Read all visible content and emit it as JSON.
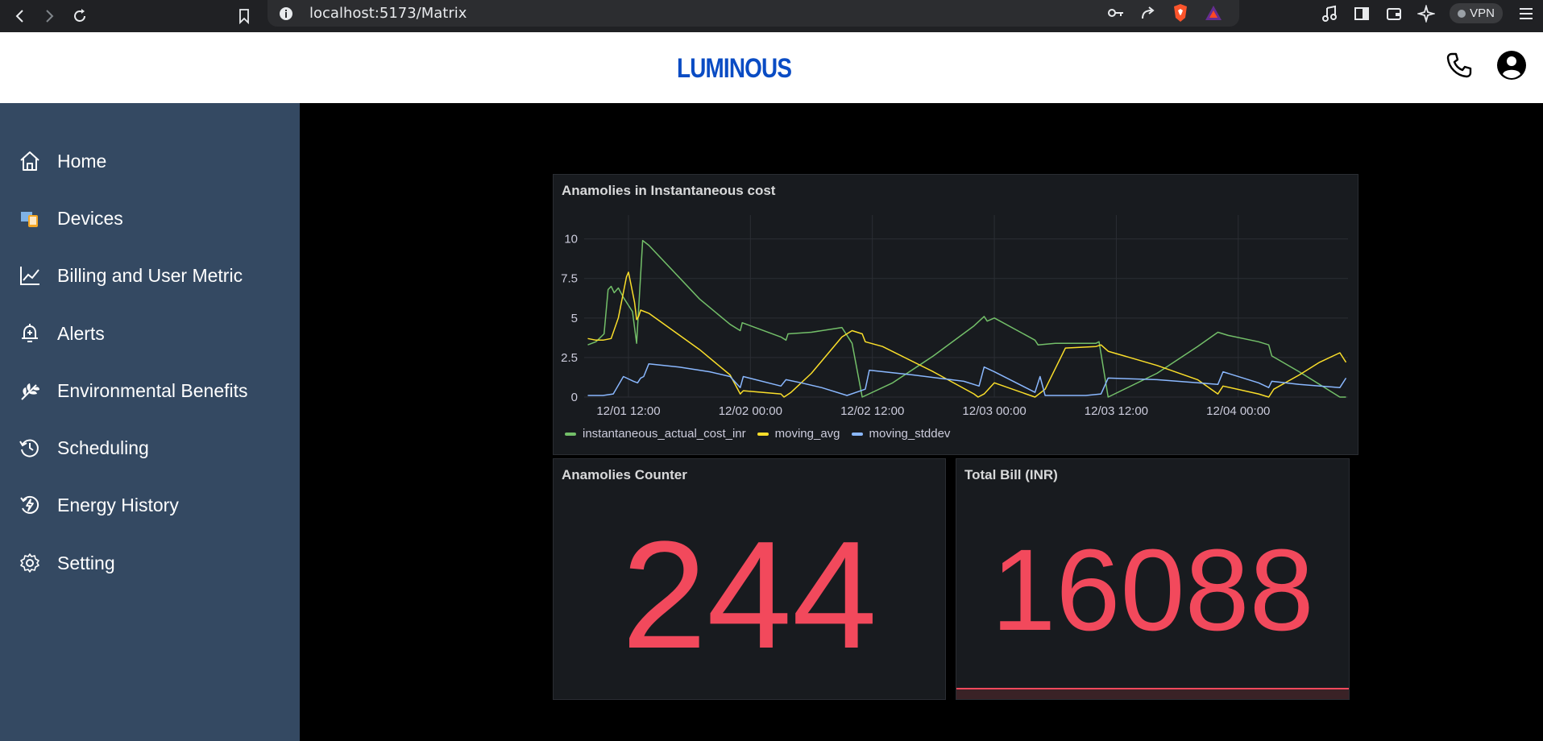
{
  "browser": {
    "url": "localhost:5173/Matrix",
    "vpn_label": "VPN"
  },
  "header": {
    "logo": "LUMINOUS"
  },
  "sidebar": {
    "items": [
      {
        "label": "Home",
        "icon": "home-icon"
      },
      {
        "label": "Devices",
        "icon": "devices-icon"
      },
      {
        "label": "Billing and User Metric",
        "icon": "chart-line-icon"
      },
      {
        "label": "Alerts",
        "icon": "alert-bell-icon"
      },
      {
        "label": "Environmental Benefits",
        "icon": "leaf-icon"
      },
      {
        "label": "Scheduling",
        "icon": "history-clock-icon"
      },
      {
        "label": "Energy History",
        "icon": "energy-bolt-icon"
      },
      {
        "label": "Setting",
        "icon": "gear-icon"
      }
    ]
  },
  "panels": {
    "chart_title": "Anamolies in Instantaneous cost",
    "counter_title": "Anamolies Counter",
    "counter_value": "244",
    "bill_title": "Total Bill (INR)",
    "bill_value": "16088"
  },
  "colors": {
    "sidebar_bg": "#344962",
    "panel_bg": "#181b1f",
    "stat_red": "#f2495c",
    "series_green": "#73bf69",
    "series_yellow": "#fade2a",
    "series_blue": "#8ab8ff"
  },
  "chart_data": {
    "type": "line",
    "title": "Anamolies in Instantaneous cost",
    "x_ticks": [
      "12/01 12:00",
      "12/02 00:00",
      "12/02 12:00",
      "12/03 00:00",
      "12/03 12:00",
      "12/04 00:00"
    ],
    "x_tick_hours": [
      12,
      24,
      36,
      48,
      60,
      72
    ],
    "xlim_hours": [
      7.8,
      82.8
    ],
    "y_ticks": [
      "0",
      "2.5",
      "5",
      "7.5",
      "10"
    ],
    "ylim": [
      0,
      11
    ],
    "grid": true,
    "legend_position": "bottom-left",
    "series": [
      {
        "name": "instantaneous_actual_cost_inr",
        "color": "#73bf69",
        "points": [
          [
            8.0,
            3.3
          ],
          [
            8.8,
            3.5
          ],
          [
            9.6,
            4.0
          ],
          [
            10.0,
            6.8
          ],
          [
            10.3,
            7.0
          ],
          [
            10.6,
            6.6
          ],
          [
            11.0,
            6.9
          ],
          [
            11.5,
            6.3
          ],
          [
            12.0,
            5.8
          ],
          [
            12.4,
            5.4
          ],
          [
            12.8,
            3.4
          ],
          [
            13.4,
            9.9
          ],
          [
            14.0,
            9.6
          ],
          [
            19.0,
            6.2
          ],
          [
            22.0,
            4.6
          ],
          [
            23.0,
            4.2
          ],
          [
            23.2,
            4.7
          ],
          [
            27.0,
            3.8
          ],
          [
            27.5,
            3.6
          ],
          [
            27.7,
            4.0
          ],
          [
            30.0,
            4.1
          ],
          [
            33.0,
            4.4
          ],
          [
            34.0,
            3.4
          ],
          [
            35.0,
            0.0
          ],
          [
            38.0,
            0.9
          ],
          [
            42.0,
            2.6
          ],
          [
            46.0,
            4.5
          ],
          [
            47.0,
            5.1
          ],
          [
            47.3,
            4.8
          ],
          [
            48.0,
            5.0
          ],
          [
            52.0,
            3.6
          ],
          [
            52.3,
            3.3
          ],
          [
            54.0,
            3.4
          ],
          [
            58.0,
            3.4
          ],
          [
            58.3,
            3.5
          ],
          [
            59.2,
            0.0
          ],
          [
            64.0,
            1.5
          ],
          [
            68.0,
            3.2
          ],
          [
            70.0,
            4.1
          ],
          [
            71.0,
            3.9
          ],
          [
            74.0,
            3.5
          ],
          [
            75.0,
            3.3
          ],
          [
            75.3,
            2.6
          ],
          [
            78.0,
            1.6
          ],
          [
            80.0,
            0.8
          ],
          [
            82.0,
            0.0
          ],
          [
            82.6,
            0.0
          ]
        ]
      },
      {
        "name": "moving_avg",
        "color": "#fade2a",
        "points": [
          [
            8.0,
            3.7
          ],
          [
            8.8,
            3.6
          ],
          [
            9.5,
            3.6
          ],
          [
            10.3,
            3.7
          ],
          [
            11.0,
            5.0
          ],
          [
            11.8,
            7.6
          ],
          [
            12.0,
            7.9
          ],
          [
            12.6,
            6.0
          ],
          [
            12.8,
            4.9
          ],
          [
            13.0,
            5.1
          ],
          [
            13.2,
            5.5
          ],
          [
            14.0,
            5.3
          ],
          [
            19.0,
            3.0
          ],
          [
            22.0,
            1.4
          ],
          [
            23.0,
            0.2
          ],
          [
            23.3,
            0.4
          ],
          [
            27.0,
            0.2
          ],
          [
            27.3,
            0.0
          ],
          [
            28.0,
            0.3
          ],
          [
            30.0,
            1.5
          ],
          [
            33.0,
            3.8
          ],
          [
            34.0,
            4.2
          ],
          [
            35.0,
            4.0
          ],
          [
            35.3,
            3.5
          ],
          [
            37.0,
            3.2
          ],
          [
            42.0,
            1.6
          ],
          [
            46.0,
            0.2
          ],
          [
            46.4,
            0.0
          ],
          [
            47.0,
            0.2
          ],
          [
            48.0,
            0.9
          ],
          [
            52.0,
            0.0
          ],
          [
            53.0,
            0.5
          ],
          [
            55.0,
            3.1
          ],
          [
            58.0,
            3.2
          ],
          [
            58.5,
            3.3
          ],
          [
            59.2,
            2.9
          ],
          [
            64.0,
            2.0
          ],
          [
            68.0,
            1.1
          ],
          [
            70.0,
            0.2
          ],
          [
            70.5,
            0.7
          ],
          [
            74.0,
            0.2
          ],
          [
            75.0,
            0.0
          ],
          [
            75.5,
            0.5
          ],
          [
            78.0,
            1.4
          ],
          [
            80.0,
            2.2
          ],
          [
            82.0,
            2.8
          ],
          [
            82.6,
            2.2
          ]
        ]
      },
      {
        "name": "moving_stddev",
        "color": "#8ab8ff",
        "points": [
          [
            8.0,
            0.1
          ],
          [
            9.5,
            0.1
          ],
          [
            10.5,
            0.2
          ],
          [
            11.5,
            1.3
          ],
          [
            12.5,
            1.0
          ],
          [
            12.9,
            0.9
          ],
          [
            13.2,
            1.2
          ],
          [
            13.5,
            1.3
          ],
          [
            14.0,
            2.1
          ],
          [
            17.0,
            1.9
          ],
          [
            20.0,
            1.6
          ],
          [
            22.0,
            1.3
          ],
          [
            23.0,
            0.6
          ],
          [
            23.3,
            1.3
          ],
          [
            27.0,
            0.7
          ],
          [
            27.5,
            1.1
          ],
          [
            29.0,
            0.9
          ],
          [
            31.0,
            0.6
          ],
          [
            33.5,
            0.1
          ],
          [
            35.3,
            0.5
          ],
          [
            35.7,
            1.7
          ],
          [
            40.0,
            1.4
          ],
          [
            45.0,
            1.0
          ],
          [
            46.5,
            0.7
          ],
          [
            47.0,
            1.9
          ],
          [
            48.0,
            1.6
          ],
          [
            52.0,
            0.3
          ],
          [
            52.5,
            1.3
          ],
          [
            53.0,
            0.1
          ],
          [
            57.0,
            0.1
          ],
          [
            58.5,
            0.2
          ],
          [
            59.2,
            1.2
          ],
          [
            64.0,
            1.1
          ],
          [
            68.0,
            0.9
          ],
          [
            70.0,
            0.8
          ],
          [
            70.5,
            1.6
          ],
          [
            74.0,
            0.9
          ],
          [
            75.0,
            0.6
          ],
          [
            75.3,
            1.0
          ],
          [
            78.0,
            0.8
          ],
          [
            82.0,
            0.6
          ],
          [
            82.6,
            1.2
          ]
        ]
      }
    ]
  }
}
